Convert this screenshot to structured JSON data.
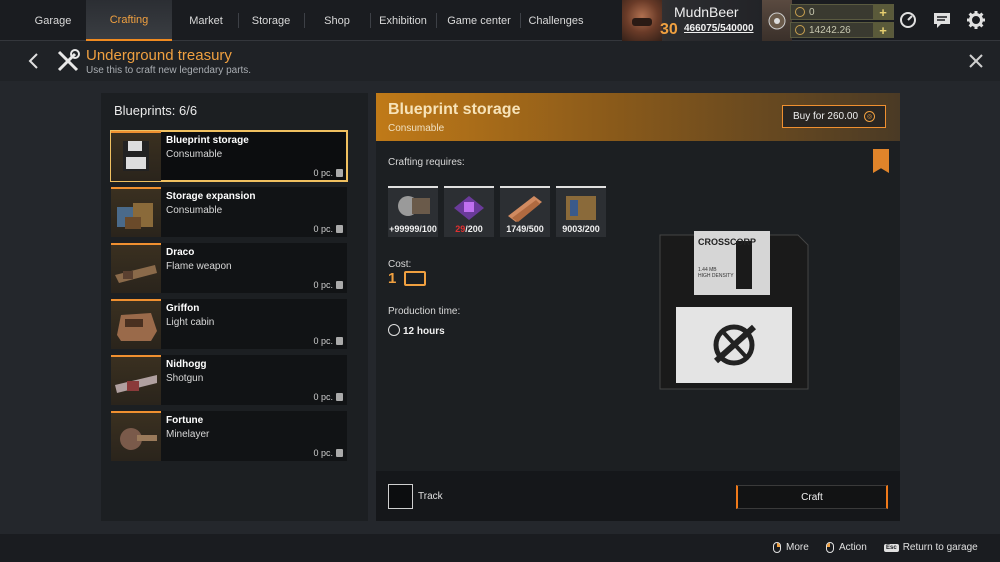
{
  "nav": {
    "tabs": [
      {
        "label": "Garage"
      },
      {
        "label": "Crafting"
      },
      {
        "label": "Market"
      },
      {
        "label": "Storage"
      },
      {
        "label": "Shop"
      },
      {
        "label": "Exhibition"
      },
      {
        "label": "Game center"
      },
      {
        "label": "Challenges"
      }
    ],
    "active_tab": "Crafting"
  },
  "player": {
    "name": "MudnBeer",
    "level": "30",
    "xp": "466075/540000"
  },
  "currencies": {
    "gold": "0",
    "coins": "14242.26"
  },
  "header": {
    "title": "Underground treasury",
    "subtitle": "Use this to craft new legendary parts."
  },
  "blueprints": {
    "count_label": "Blueprints: 6/6",
    "items": [
      {
        "name": "Blueprint storage",
        "type": "Consumable",
        "qty": "0 pc."
      },
      {
        "name": "Storage expansion",
        "type": "Consumable",
        "qty": "0 pc."
      },
      {
        "name": "Draco",
        "type": "Flame weapon",
        "qty": "0 pc."
      },
      {
        "name": "Griffon",
        "type": "Light cabin",
        "qty": "0 pc."
      },
      {
        "name": "Nidhogg",
        "type": "Shotgun",
        "qty": "0 pc."
      },
      {
        "name": "Fortune",
        "type": "Minelayer",
        "qty": "0 pc."
      }
    ]
  },
  "detail": {
    "title": "Blueprint storage",
    "subtitle": "Consumable",
    "buy_label": "Buy for 260.00",
    "requires_label": "Crafting requires:",
    "materials": [
      {
        "count": "+99999/100"
      },
      {
        "have": "29",
        "need": "/200"
      },
      {
        "count": "1749/500"
      },
      {
        "count": "9003/200"
      }
    ],
    "cost_label": "Cost:",
    "cost_value": "1",
    "time_label": "Production time:",
    "time_value": "12 hours",
    "floppy_brand": "CROSSCORP",
    "floppy_spec": "1.44 MB",
    "floppy_spec2": "HIGH DENSITY",
    "track_label": "Track",
    "craft_label": "Craft"
  },
  "footer": {
    "more": "More",
    "action": "Action",
    "esc_key": "Esc",
    "return": "Return to garage"
  }
}
